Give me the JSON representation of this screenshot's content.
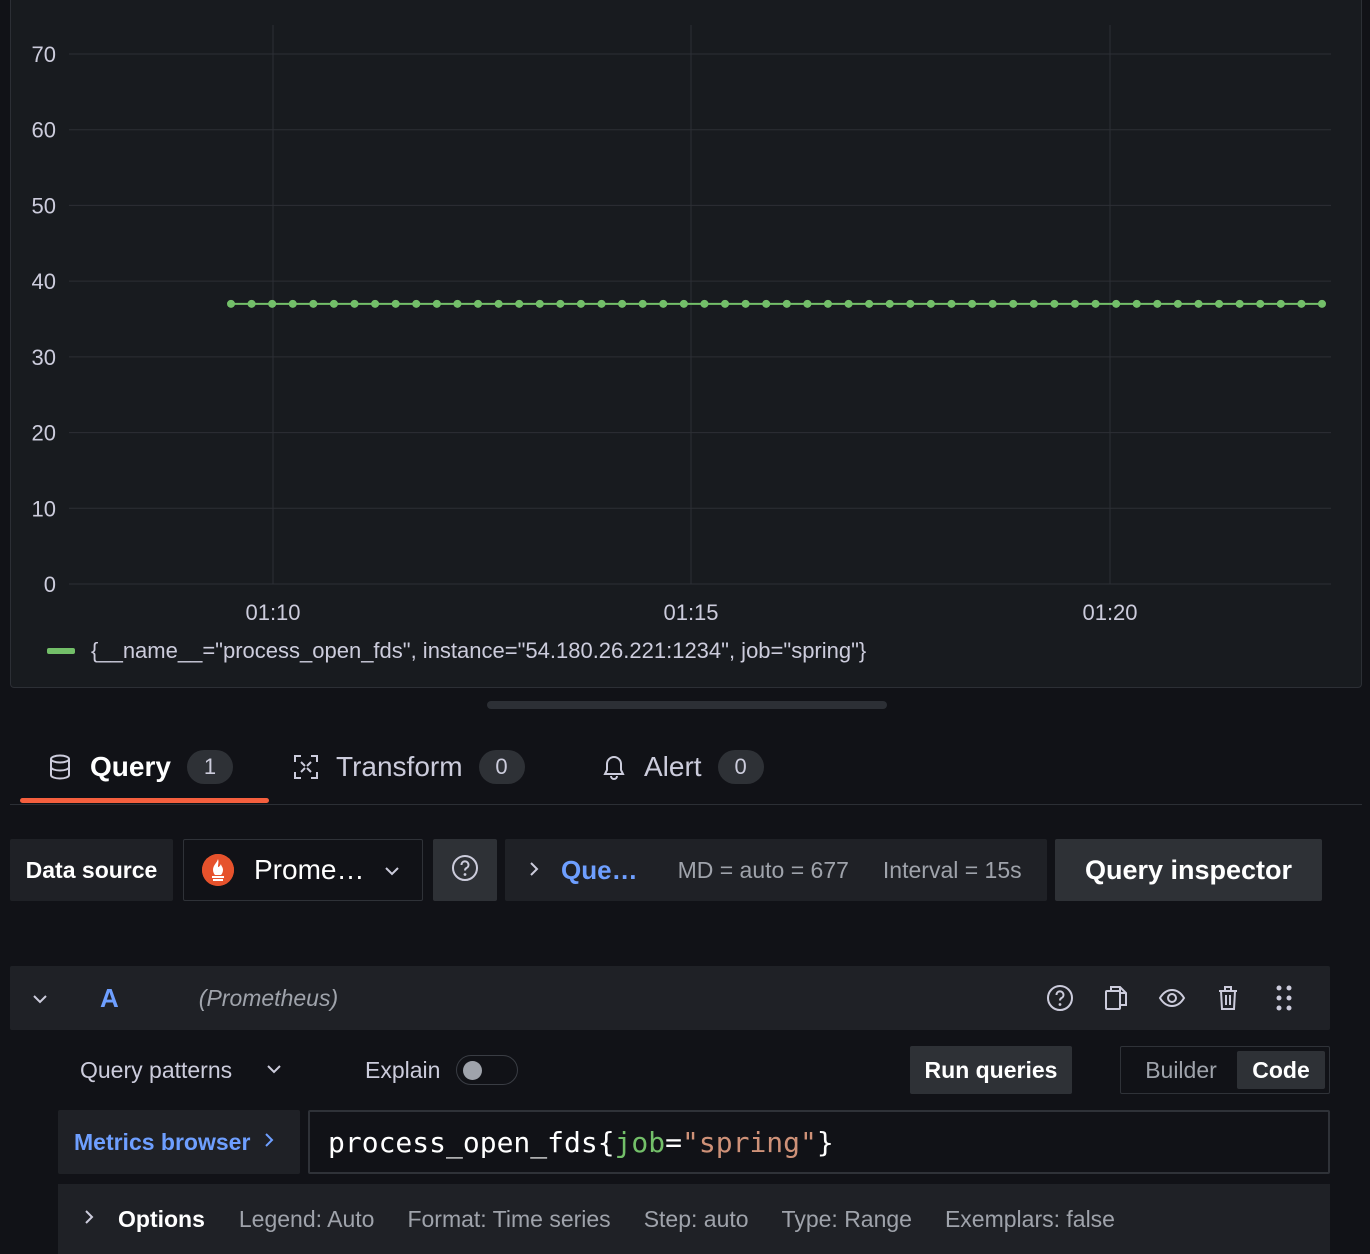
{
  "chart_data": {
    "type": "line",
    "yticks": [
      "70",
      "60",
      "50",
      "40",
      "30",
      "20",
      "10",
      "0"
    ],
    "ylim": [
      0,
      70
    ],
    "xticks": [
      "01:10",
      "01:15",
      "01:20"
    ],
    "series": [
      {
        "name": "{__name__=\"process_open_fds\", instance=\"54.180.26.221:1234\", job=\"spring\"}",
        "constant_value": 37,
        "points": 54,
        "color": "#73bf69"
      }
    ],
    "grid": true
  },
  "tabs": [
    {
      "label": "Query",
      "count": "1",
      "icon": "database-icon"
    },
    {
      "label": "Transform",
      "count": "0",
      "icon": "transform-icon"
    },
    {
      "label": "Alert",
      "count": "0",
      "icon": "bell-icon"
    }
  ],
  "toolbar": {
    "data_source_label": "Data source",
    "data_source_value": "Prome…",
    "query_options_title": "Que…",
    "md_info": "MD = auto = 677",
    "interval_info": "Interval = 15s",
    "query_inspector_label": "Query inspector"
  },
  "query_row": {
    "ref_id": "A",
    "datasource": "(Prometheus)"
  },
  "controls": {
    "query_patterns_label": "Query patterns",
    "explain_label": "Explain",
    "run_queries_label": "Run queries",
    "builder_label": "Builder",
    "code_label": "Code"
  },
  "editor": {
    "metrics_browser_label": "Metrics browser",
    "metric": "process_open_fds",
    "open_brace": "{",
    "label_key": "job",
    "equals": "=",
    "label_value": "\"spring\"",
    "close_brace": "}"
  },
  "options": {
    "label": "Options",
    "legend": "Legend: Auto",
    "format": "Format: Time series",
    "step": "Step: auto",
    "type": "Type: Range",
    "exemplars": "Exemplars: false"
  },
  "colors": {
    "accent": "#f55f3e",
    "link": "#6e9fff",
    "series": "#73bf69"
  }
}
